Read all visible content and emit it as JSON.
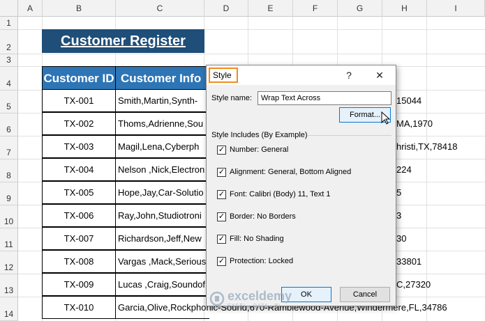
{
  "columns": [
    "A",
    "B",
    "C",
    "D",
    "E",
    "F",
    "G",
    "H",
    "I"
  ],
  "rows": [
    "1",
    "2",
    "3",
    "4",
    "5",
    "6",
    "7",
    "8",
    "9",
    "10",
    "11",
    "12",
    "13",
    "14"
  ],
  "sheet": {
    "title": "Customer Register",
    "headers": {
      "id": "Customer ID",
      "info": "Customer Info"
    },
    "records": [
      {
        "id": "TX-001",
        "info": "Smith,Martin,Synth-",
        "tail": "15044"
      },
      {
        "id": "TX-002",
        "info": "Thoms,Adrienne,Sou",
        "tail": "MA,1970"
      },
      {
        "id": "TX-003",
        "info": "Magil,Lena,Cyberph",
        "tail": "hristi,TX,78418"
      },
      {
        "id": "TX-004",
        "info": "Nelson ,Nick,Electron",
        "tail": "224"
      },
      {
        "id": "TX-005",
        "info": "Hope,Jay,Car-Solutio",
        "tail": "5"
      },
      {
        "id": "TX-006",
        "info": "Ray,John,Studiotroni",
        "tail": "3"
      },
      {
        "id": "TX-007",
        "info": "Richardson,Jeff,New",
        "tail": "30"
      },
      {
        "id": "TX-008",
        "info": "Vargas ,Mack,Serious",
        "tail": "33801"
      },
      {
        "id": "TX-009",
        "info": "Lucas ,Craig,Soundof",
        "tail": "C,27320"
      },
      {
        "id": "TX-010",
        "info": "Garcia,Olive,Rockphonic-Sound,670-Ramblewood-Avenue,Windermere,FL,34786",
        "tail": ""
      }
    ]
  },
  "dialog": {
    "title": "Style",
    "help": "?",
    "close": "✕",
    "style_name_label": "Style name:",
    "style_name_value": "Wrap Text Across",
    "format_button": "Format...",
    "group_label": "Style Includes (By Example)",
    "options": [
      {
        "label": "Number: General",
        "checked": true
      },
      {
        "label": "Alignment: General, Bottom Aligned",
        "checked": true
      },
      {
        "label": "Font: Calibri (Body) 11, Text 1",
        "checked": true
      },
      {
        "label": "Border: No Borders",
        "checked": true
      },
      {
        "label": "Fill: No Shading",
        "checked": true
      },
      {
        "label": "Protection: Locked",
        "checked": true
      }
    ],
    "ok_button": "OK",
    "cancel_button": "Cancel"
  },
  "watermark": {
    "name": "exceldemy",
    "tagline": "EXCEL · DATA · BI"
  },
  "colors": {
    "title_bg": "#1f4e79",
    "header_bg": "#2e75b6",
    "highlight": "#f28c1e"
  }
}
